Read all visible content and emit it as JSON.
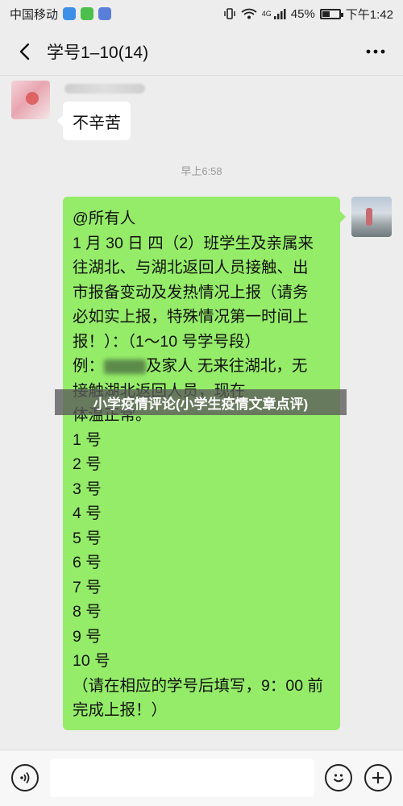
{
  "status_bar": {
    "carrier": "中国移动",
    "battery": "45%",
    "battery_level": 0.45,
    "time": "下午1:42",
    "signal_label": "4G"
  },
  "header": {
    "title": "学号1–10(14)",
    "back_icon": "chevron-left-icon",
    "more_icon": "more-icon"
  },
  "messages": [
    {
      "side": "left",
      "text": "不辛苦"
    },
    {
      "side": "right",
      "lines": [
        "@所有人",
        "1 月 30 日 四（2）班学生及亲属来",
        "往湖北、与湖北返回人员接触、出",
        "市报备变动及发热情况上报（请务",
        "必如实上报，特殊情况第一时间上",
        "报！）：（1～10 号学号段）",
        "例：",
        "及家人 无来往湖北，无",
        "接触湖北返回人员，现在",
        "体温正常。",
        "1 号",
        "2 号",
        "3 号",
        "4 号",
        "5 号",
        "6 号",
        "7 号",
        "8 号",
        "9 号",
        "10 号",
        "（请在相应的学号后填写，9：00 前",
        "完成上报！）"
      ]
    }
  ],
  "timestamp": "早上6:58",
  "overlay_caption": "小学疫情评论(小学生疫情文章点评)",
  "input_bar": {
    "voice_icon": "voice-icon",
    "emoji_icon": "emoji-icon",
    "plus_icon": "plus-icon"
  },
  "colors": {
    "background": "#ededed",
    "bubble_green": "#95ec69",
    "bubble_white": "#ffffff"
  }
}
